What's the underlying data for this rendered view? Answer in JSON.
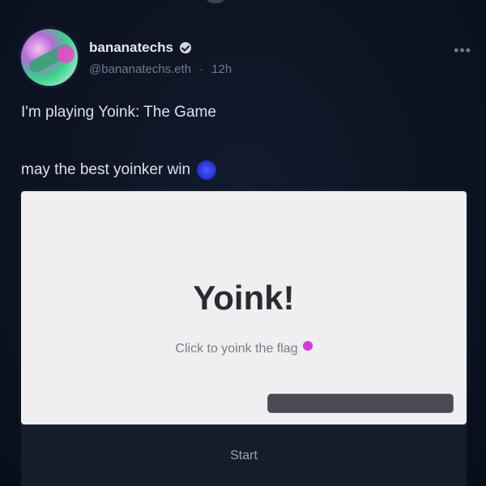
{
  "cast": {
    "author": {
      "display_name": "bananatechs",
      "username": "@bananatechs.eth",
      "separator": "·",
      "time": "12h"
    },
    "text_line1": "I'm playing Yoink: The Game",
    "text_line2": "may the best yoinker win"
  },
  "frame": {
    "title": "Yoink!",
    "subtitle": "Click to yoink the flag"
  },
  "action": {
    "label": "Start"
  },
  "colors": {
    "background": "#0d1524",
    "frame_bg": "#efeff1",
    "accent_blue": "#2a33d6",
    "accent_pink": "#d43ad8"
  }
}
